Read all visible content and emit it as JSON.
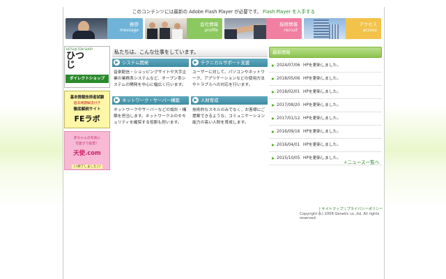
{
  "flash_notice": {
    "text": "このコンテンツには最新の Adobe Flash Player が必要です。",
    "link": "Flash Player を入手する"
  },
  "nav": [
    {
      "jp": "挨拶",
      "en": "message",
      "color": "#6fb3d8"
    },
    {
      "jp": "会社情報",
      "en": "profile",
      "color": "#8cc860"
    },
    {
      "jp": "採用情報",
      "en": "recruit",
      "color": "#f07fa2"
    },
    {
      "jp": "アクセス",
      "en": "access",
      "color": "#f2c24a"
    }
  ],
  "sidebar": {
    "banner1": {
      "title": "ひつじ",
      "sub": "ダイレクトショップ",
      "tag": "HITSUJI TEN SHOP"
    },
    "banner2": {
      "line1": "基本情報技術者試験",
      "line2": "過去問題解説付き",
      "line3": "徹底解説サイト",
      "big": "FEラボ"
    },
    "banner3": {
      "line1": "赤ちゃんの写真に",
      "line2": "可愛さで投票！",
      "big": "天使.com",
      "sub": "♪♪終了しました♪♪"
    }
  },
  "main": {
    "intro": "私たちは、こんな仕事をしています。",
    "services": [
      {
        "title": "システム開発",
        "body": "音楽配信・ショッピングサイトや大手企業の業務系システムなど、オープン系システムの開発を中心に幅広く行います。"
      },
      {
        "title": "テクニカルサポート支援",
        "body": "ユーザーに対して、パソコンやネットワーク、アプリケーションなどの使用方法やトラブルへの対応を行います。"
      },
      {
        "title": "ネットワーク・サーバー構築",
        "body": "ネットワークやサーバーなどの設計・構築を担当します。ネットワーク上のセキュリティを確保する役割も担います。"
      },
      {
        "title": "人財育成",
        "body": "技術的なスキルのみでなく、お客様にご提案できるような、コミュニケーション能力の高い人財を育成します。"
      }
    ]
  },
  "news": {
    "heading": "最新情報",
    "items": [
      {
        "date": "2024/07/06",
        "text": "HPを更新しました。"
      },
      {
        "date": "2018/05/06",
        "text": "HPを更新しました。"
      },
      {
        "date": "2018/02/01",
        "text": "HPを更新しました。"
      },
      {
        "date": "2017/08/20",
        "text": "HPを更新しました。"
      },
      {
        "date": "2017/01/12",
        "text": "HPを更新しました。"
      },
      {
        "date": "2016/09/16",
        "text": "HPを更新しました。"
      },
      {
        "date": "2016/04/01",
        "text": "HPを更新しました。"
      },
      {
        "date": "2015/10/05",
        "text": "HPを更新しました。"
      }
    ],
    "more": "ニュース一覧へ"
  },
  "footer": {
    "sitemap": "サイトマップ",
    "privacy": "プライバシーポリシー",
    "copyright": "Copyright (c) 2008 Genetic co.,ltd. All rights reserved."
  }
}
